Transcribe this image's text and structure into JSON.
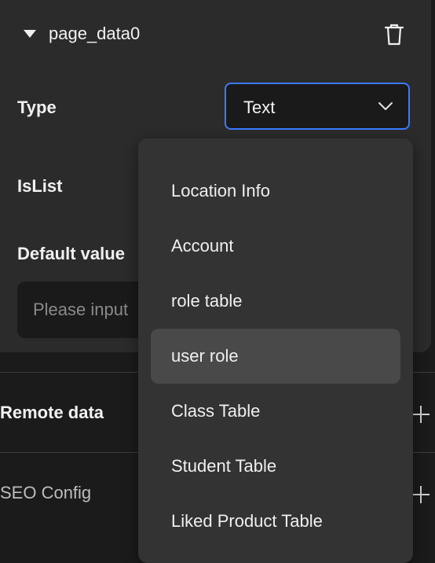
{
  "card": {
    "title": "page_data0",
    "fields": {
      "type_label": "Type",
      "type_value": "Text",
      "islist_label": "IsList",
      "default_label": "Default value",
      "default_placeholder": "Please input"
    }
  },
  "sections": {
    "remote_data": "Remote data",
    "seo_config": "SEO Config"
  },
  "dropdown": {
    "items": [
      "Location Info",
      "Account",
      "role table",
      "user role",
      "Class Table",
      "Student Table",
      "Liked Product Table"
    ],
    "highlighted": "user role"
  },
  "icons": {
    "collapse": "caret-down-icon",
    "delete": "trash-icon",
    "select_arrow": "chevron-down-icon",
    "add": "plus-icon"
  },
  "colors": {
    "accent": "#3b7bff",
    "panel": "#2b2b2b",
    "background": "#1b1b1b",
    "menu": "#333333",
    "menu_hover": "#494949"
  }
}
